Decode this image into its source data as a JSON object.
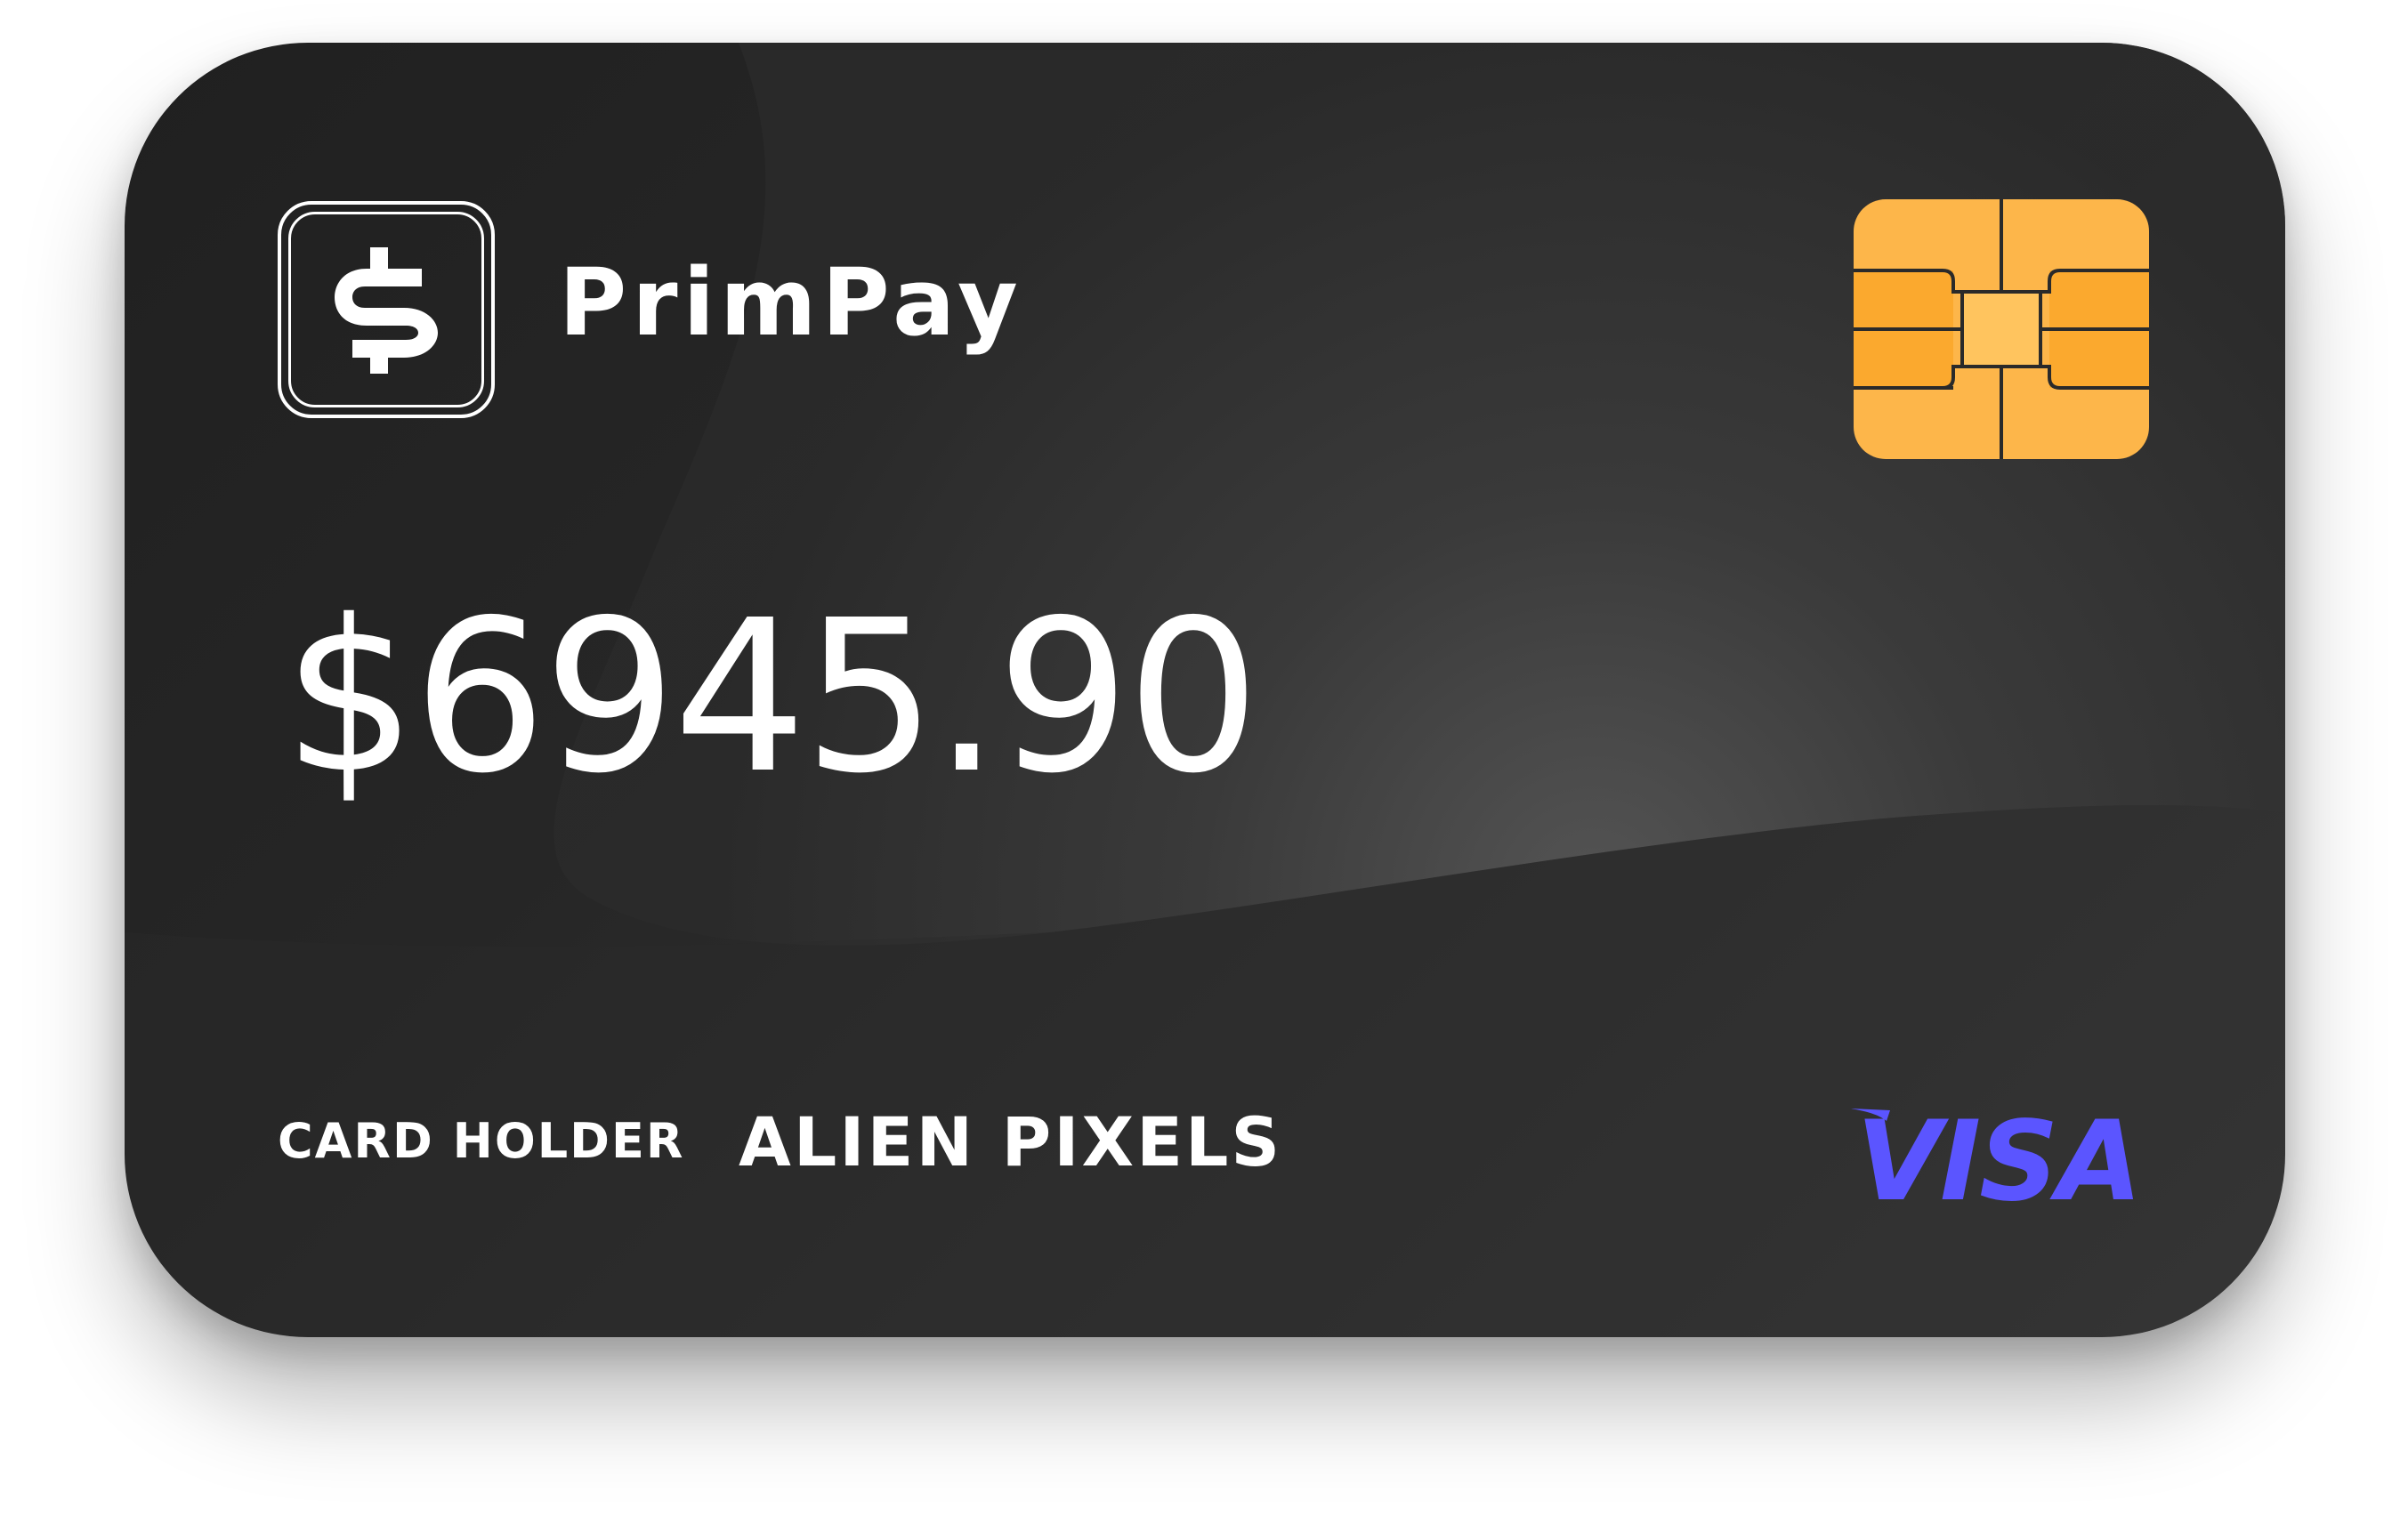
{
  "card": {
    "brand": {
      "name": "PrimPay",
      "icon": "dollar-sign-icon"
    },
    "balance": "$6945.90",
    "holder_label": "CARD HOLDER",
    "holder_name": "ALIEN PIXELS",
    "network": "VISA",
    "chip_icon": "emv-chip-icon"
  },
  "colors": {
    "card_dark": "#232323",
    "text": "#ffffff",
    "chip_gold": "#fdb64a",
    "chip_orange": "#fba92e",
    "network_blue": "#5b55ff"
  }
}
